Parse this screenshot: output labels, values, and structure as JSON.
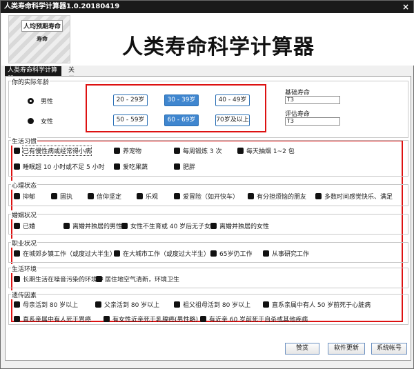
{
  "window": {
    "title": "人类寿命科学计算器1.0.20180419",
    "close": "×"
  },
  "banner": {
    "logo_title": "人均预期寿命",
    "logo_sub": "寿命",
    "title": "人类寿命科学计算器"
  },
  "tabs": [
    {
      "label": "人类寿命科学计算器"
    },
    {
      "label": "关于"
    }
  ],
  "age": {
    "group_label": "你的实际年龄",
    "male": "男性",
    "female": "女性",
    "buttons": [
      {
        "label": "20 - 29岁",
        "selected": false
      },
      {
        "label": "30 - 39岁",
        "selected": true
      },
      {
        "label": "40 - 49岁",
        "selected": false
      },
      {
        "label": "50 - 59岁",
        "selected": false
      },
      {
        "label": "60 - 69岁",
        "selected": true
      },
      {
        "label": "70岁及以上",
        "selected": false
      }
    ],
    "base_label": "基础寿命",
    "base_value": "T3",
    "eval_label": "评估寿命",
    "eval_value": "T3"
  },
  "habits": {
    "label": "生活习惯",
    "items": [
      "已有慢性病或经常得小病",
      "养宠物",
      "每周锻炼 3 次",
      "每天抽烟 1~2 包",
      "睡眠超 10 小时或不足 5 小时",
      "爱吃果蔬",
      "肥胖"
    ]
  },
  "mental": {
    "label": "心理状态",
    "items": [
      "抑郁",
      "固执",
      "信仰坚定",
      "乐观",
      "爱冒险（如开快车）",
      "有分担烦恼的朋友",
      "多数时间感觉快乐、满足"
    ]
  },
  "marriage": {
    "label": "婚姻状况",
    "items": [
      "已婚",
      "离婚并独居的男性",
      "女性不生育或 40 岁后无子女",
      "离婚并独居的女性"
    ]
  },
  "career": {
    "label": "职业状况",
    "items": [
      "在城郊乡镇工作（或度过大半生）",
      "在大城市工作（或度过大半生）",
      "65岁仍工作",
      "从事研究工作"
    ]
  },
  "environment": {
    "label": "生活环境",
    "items": [
      "长期生活在噪音污染的环境中",
      "居住地空气清新，环境卫生"
    ]
  },
  "genetics": {
    "label": "遗传因素",
    "items": [
      "母亲活到 80 岁以上",
      "父亲活到 80 岁以上",
      "祖父祖母活到 80 岁以上",
      "直系亲属中有人 50 岁前死于心脏病",
      "直系亲属中有人死于胃癌",
      "有女性近亲死于乳腺癌(男性略)",
      "有近亲 60 岁前死于自杀或其他疾病"
    ]
  },
  "footer": {
    "donate": "赞赏",
    "update": "软件更新",
    "contact": "系统帐号"
  }
}
